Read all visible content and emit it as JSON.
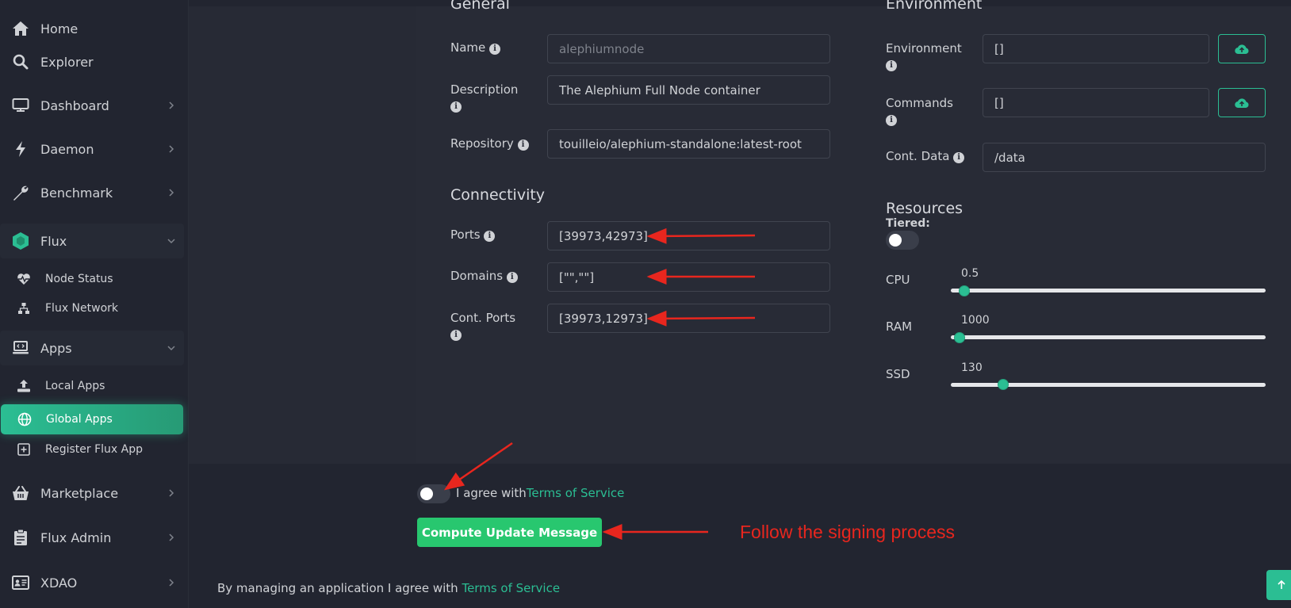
{
  "sidebar": {
    "home": "Home",
    "explorer": "Explorer",
    "dashboard": "Dashboard",
    "daemon": "Daemon",
    "benchmark": "Benchmark",
    "flux": "Flux",
    "node_status": "Node Status",
    "flux_network": "Flux Network",
    "apps": "Apps",
    "local_apps": "Local Apps",
    "global_apps": "Global Apps",
    "register_flux_app": "Register Flux App",
    "marketplace": "Marketplace",
    "flux_admin": "Flux Admin",
    "xdao": "XDAO"
  },
  "general": {
    "title": "General",
    "name_label": "Name",
    "name_placeholder": "alephiumnode",
    "description_label": "Description",
    "description_value": "The Alephium Full Node container",
    "repository_label": "Repository",
    "repository_value": "touilleio/alephium-standalone:latest-root"
  },
  "connectivity": {
    "title": "Connectivity",
    "ports_label": "Ports",
    "ports_value": "[39973,42973]",
    "domains_label": "Domains",
    "domains_value": "[\"\",\"\"]",
    "cont_ports_label": "Cont. Ports",
    "cont_ports_value": "[39973,12973]"
  },
  "environment": {
    "title": "Environment",
    "environment_label": "Environment",
    "environment_value": "[]",
    "commands_label": "Commands",
    "commands_value": "[]",
    "cont_data_label": "Cont. Data",
    "cont_data_value": "/data"
  },
  "resources": {
    "title": "Resources",
    "tiered_label": "Tiered:",
    "cpu_label": "CPU",
    "cpu_value": "0.5",
    "ram_label": "RAM",
    "ram_value": "1000",
    "ssd_label": "SSD",
    "ssd_value": "130"
  },
  "agree": {
    "text": "I agree with",
    "link": "Terms of Service"
  },
  "compute_button": "Compute Update Message",
  "annotation_text": "Follow the signing process",
  "footer": {
    "text": "By managing an application I agree with ",
    "link": "Terms of Service"
  },
  "colors": {
    "accent": "#2bbe93",
    "button_green": "#28c76f",
    "annotation_red": "#e8261e",
    "background": "#222530",
    "card": "#282b36"
  }
}
